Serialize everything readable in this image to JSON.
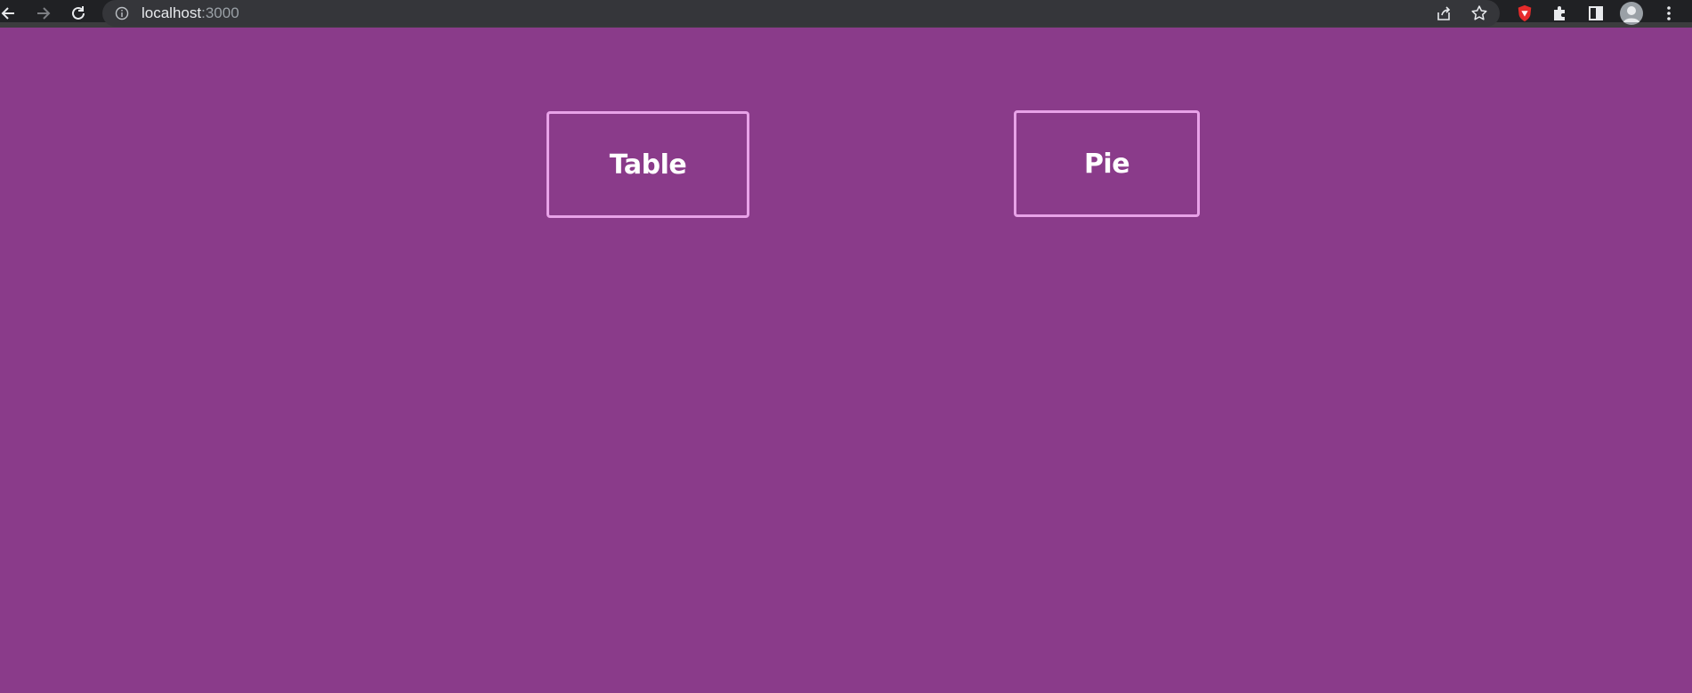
{
  "browser": {
    "url_host": "localhost",
    "url_port": ":3000"
  },
  "page": {
    "background_color": "#8a3b8a",
    "buttons": [
      {
        "label": "Table"
      },
      {
        "label": "Pie"
      }
    ]
  },
  "icons": {
    "back": "back-arrow-icon",
    "forward": "forward-arrow-icon",
    "reload": "reload-icon",
    "info": "info-icon",
    "share": "share-icon",
    "bookmark": "star-icon",
    "brave": "brave-shield-icon",
    "extensions": "puzzle-icon",
    "side_panel": "side-panel-icon",
    "profile": "avatar",
    "menu": "kebab-menu-icon"
  }
}
